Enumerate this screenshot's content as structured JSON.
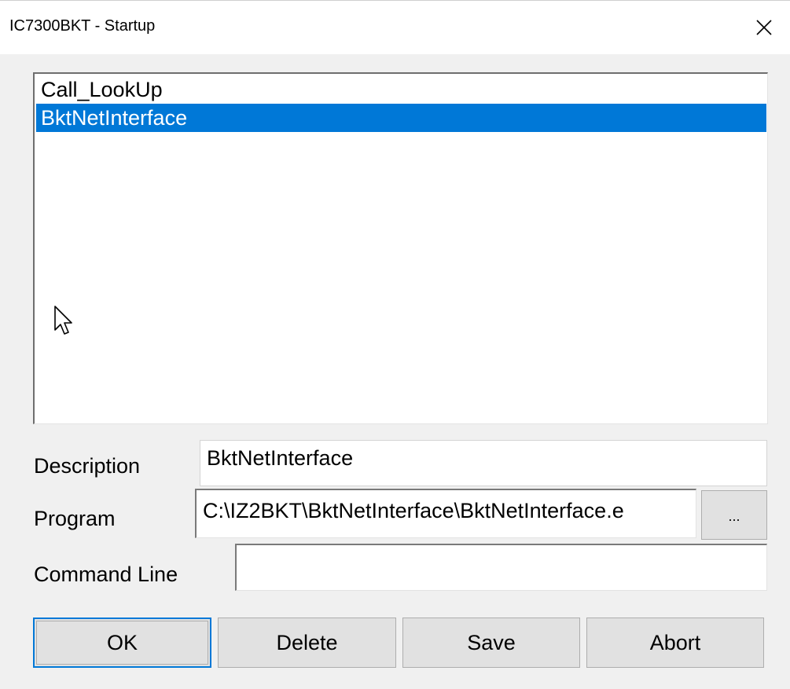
{
  "window": {
    "title": "IC7300BKT - Startup",
    "close_icon": "close-icon"
  },
  "list": {
    "items": [
      {
        "label": "Call_LookUp",
        "selected": false
      },
      {
        "label": "BktNetInterface",
        "selected": true
      }
    ]
  },
  "form": {
    "description_label": "Description",
    "description_value": "BktNetInterface",
    "program_label": "Program",
    "program_value": "C:\\IZ2BKT\\BktNetInterface\\BktNetInterface.e",
    "browse_label": "...",
    "command_line_label": "Command Line",
    "command_line_value": ""
  },
  "buttons": {
    "ok": "OK",
    "delete": "Delete",
    "save": "Save",
    "abort": "Abort"
  },
  "colors": {
    "selection": "#0078d7",
    "window_bg": "#f0f0f0",
    "button_bg": "#e1e1e1",
    "default_button_border": "#0078d7"
  }
}
